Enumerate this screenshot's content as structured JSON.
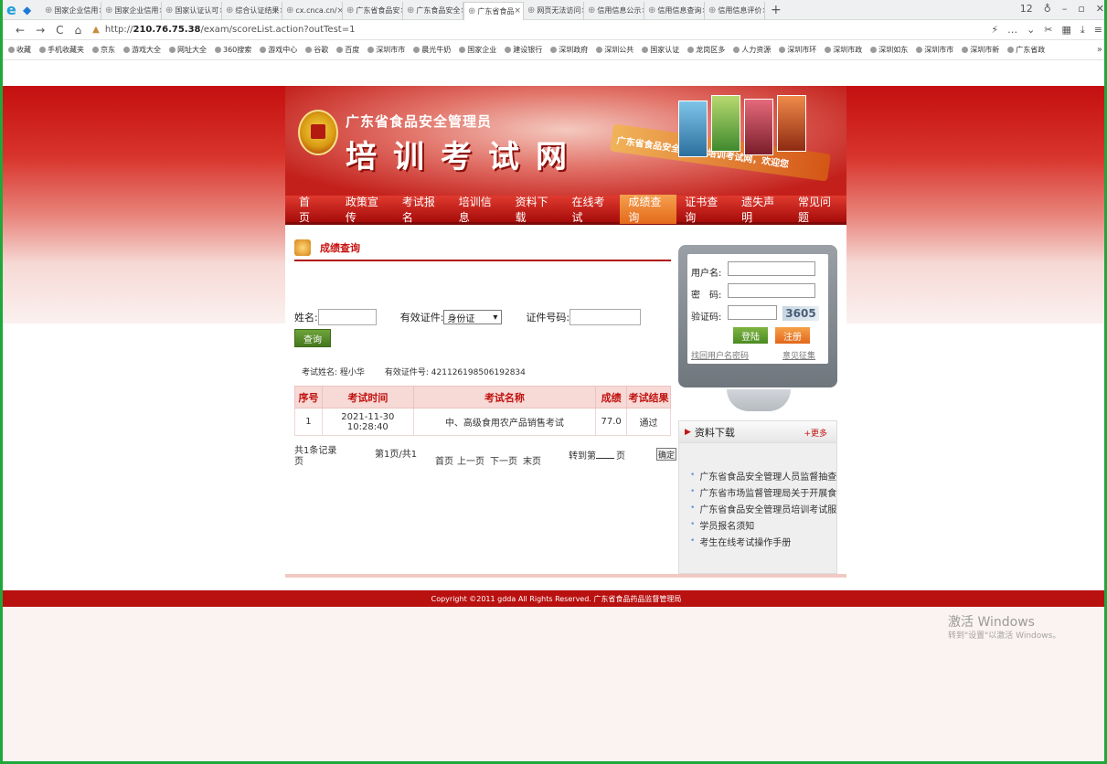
{
  "browser": {
    "tabs": [
      {
        "label": "国家企业信用",
        "active": false
      },
      {
        "label": "国家企业信用",
        "active": false
      },
      {
        "label": "国家认证认可",
        "active": false
      },
      {
        "label": "综合认证结果",
        "active": false
      },
      {
        "label": "cx.cnca.cn/",
        "active": false
      },
      {
        "label": "广东省食品安",
        "active": false
      },
      {
        "label": "广东食品安全",
        "active": false
      },
      {
        "label": "广东省食品",
        "active": true
      },
      {
        "label": "网页无法访问",
        "active": false
      },
      {
        "label": "信用信息公示",
        "active": false
      },
      {
        "label": "信用信息查询",
        "active": false
      },
      {
        "label": "信用信息评价",
        "active": false
      }
    ],
    "tab_count": "12",
    "url_prefix": "http://",
    "url_host": "210.76.75.38",
    "url_path": "/exam/scoreList.action?outTest=1",
    "bookmarks": [
      "收藏",
      "手机收藏夹",
      "京东",
      "游戏大全",
      "网址大全",
      "360搜索",
      "游戏中心",
      "谷歌",
      "百度",
      "深圳市市",
      "晨光牛奶",
      "国家企业",
      "建设银行",
      "深圳政府",
      "深圳公共",
      "国家认证",
      "龙岗区多",
      "人力资源",
      "深圳市环",
      "深圳市政",
      "深圳如东",
      "深圳市市",
      "深圳市新",
      "广东省政"
    ]
  },
  "site": {
    "subtitle": "广东省食品安全管理员",
    "title": "培训考试网",
    "slogan": "广东省食品安全管理员培训考试网，欢迎您",
    "nav": [
      {
        "label": "首　页",
        "active": false
      },
      {
        "label": "政策宣传",
        "active": false
      },
      {
        "label": "考试报名",
        "active": false
      },
      {
        "label": "培训信息",
        "active": false
      },
      {
        "label": "资料下载",
        "active": false
      },
      {
        "label": "在线考试",
        "active": false
      },
      {
        "label": "成绩查询",
        "active": true
      },
      {
        "label": "证书查询",
        "active": false
      },
      {
        "label": "遗失声明",
        "active": false
      },
      {
        "label": "常见问题",
        "active": false
      }
    ]
  },
  "score": {
    "section_title": "成绩查询",
    "name_label": "姓名:",
    "name_value": "",
    "id_type_label": "有效证件:",
    "id_type_value": "身份证",
    "id_no_label": "证件号码:",
    "id_no_value": "",
    "query_button": "查询",
    "exam_name_label": "考试姓名: 程小华",
    "exam_id_label": "有效证件号: 421126198506192834",
    "columns": [
      "序号",
      "考试时间",
      "考试名称",
      "成绩",
      "考试结果"
    ],
    "rows": [
      [
        "1",
        "2021-11-30 10:28:40",
        "中、高级食用农产品销售考试",
        "77.0",
        "通过"
      ]
    ],
    "pager": {
      "total": "共1条记录页",
      "page": "第1页/共1",
      "first": "首页",
      "prev": "上一页",
      "next": "下一页",
      "last": "末页",
      "goto": "转到第",
      "goto_unit": "页",
      "ok": "确定"
    }
  },
  "login": {
    "username_label": "用户名:",
    "password_label": "密　码:",
    "captcha_label": "验证码:",
    "captcha_value": "3605",
    "login_button": "登陆",
    "register_button": "注册",
    "forgot_link": "找回用户名密码",
    "feedback_link": "意见征集"
  },
  "downloads": {
    "title": "资料下载",
    "more": "+更多",
    "items": [
      "广东省食品安全管理人员监督抽查",
      "广东省市场监督管理局关于开展食品",
      "广东省食品安全管理员培训考试服务",
      "学员报名须知",
      "考生在线考试操作手册"
    ]
  },
  "footer": {
    "copyright": "Copyright ©2011 gdda All Rights Reserved. 广东省食品药品监督管理局"
  },
  "os": {
    "activate_title": "激活 Windows",
    "activate_sub": "转到\"设置\"以激活 Windows。"
  }
}
